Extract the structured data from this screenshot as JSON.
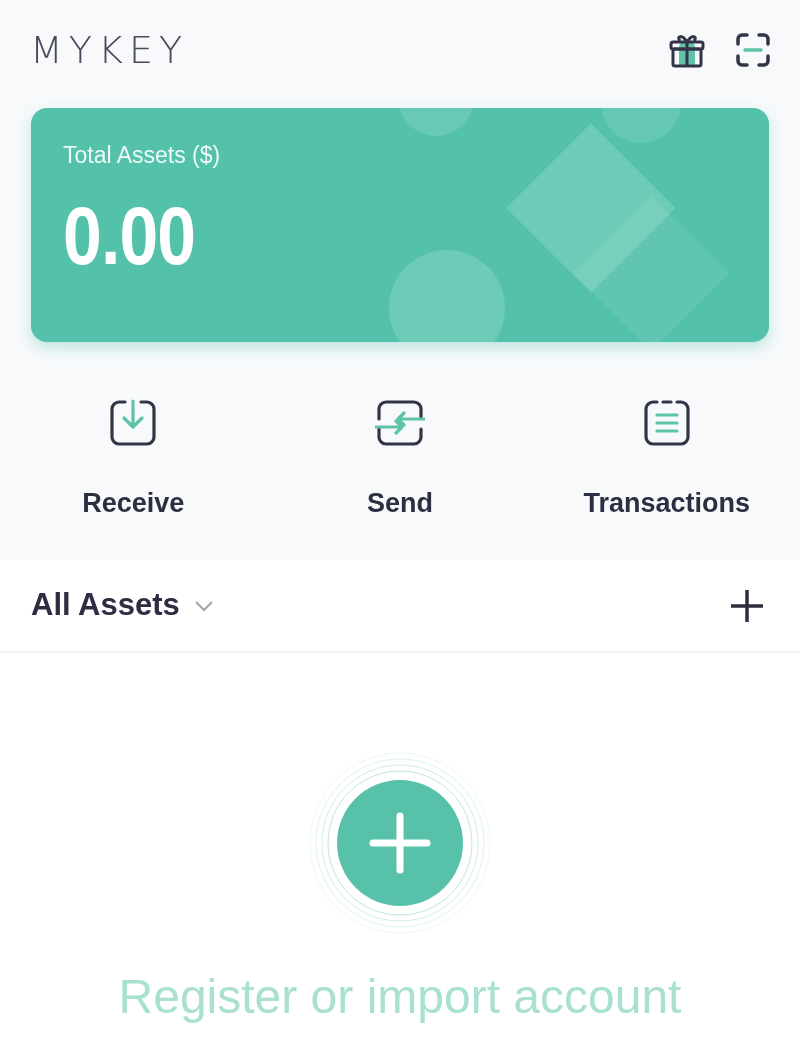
{
  "header": {
    "logo": "MYKEY"
  },
  "card": {
    "label": "Total Assets ($)",
    "amount": "0.00"
  },
  "actions": [
    {
      "kind": "receive",
      "label": "Receive"
    },
    {
      "kind": "send",
      "label": "Send"
    },
    {
      "kind": "transactions",
      "label": "Transactions"
    }
  ],
  "assets": {
    "title": "All Assets"
  },
  "empty_state": {
    "text": "Register or import account"
  }
}
